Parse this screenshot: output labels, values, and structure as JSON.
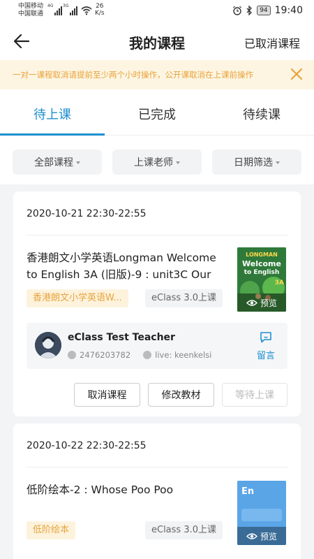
{
  "status_bar": {
    "carrier1": "中国移动",
    "carrier2": "中国联通",
    "net1": "4G",
    "net2": "3G",
    "speed_value": "26",
    "speed_unit": "K/s",
    "battery": "94",
    "time": "19:40"
  },
  "header": {
    "title": "我的课程",
    "action": "已取消课程"
  },
  "notice": {
    "text": "一对一课程取消请提前至少两个小时操作，公开课取消在上课前操作"
  },
  "tabs": [
    "待上课",
    "已完成",
    "待续课"
  ],
  "active_tab": 0,
  "filters": [
    "全部课程",
    "上课老师",
    "日期筛选"
  ],
  "colors": {
    "accent": "#1e8fcf",
    "notice_text": "#e8a33b",
    "notice_bg": "#fdf5e2"
  },
  "courses": [
    {
      "time": "2020-10-21 22:30-22:55",
      "title": "香港朗文小学英语Longman Welcome to English 3A (旧版)-9 : unit3C Our",
      "tag": "香港朗文小学英语W...",
      "platform": "eClass 3.0上课",
      "cover_line1": "LONGMAN",
      "cover_line2": "Welcome",
      "cover_line3": "to English",
      "cover_badge": "3A",
      "preview_label": "预览",
      "teacher_name": "eClass Test Teacher",
      "teacher_qq": "2476203782",
      "teacher_skype": "live: keenkelsi",
      "message_label": "留言",
      "buttons": [
        "取消课程",
        "修改教材",
        "等待上课"
      ]
    },
    {
      "time": "2020-10-22 22:30-22:55",
      "title": "低阶绘本-2 : Whose Poo Poo",
      "tag": "低阶绘本",
      "platform": "eClass 3.0上课",
      "cover_line1": "En",
      "preview_label": "预览"
    }
  ]
}
